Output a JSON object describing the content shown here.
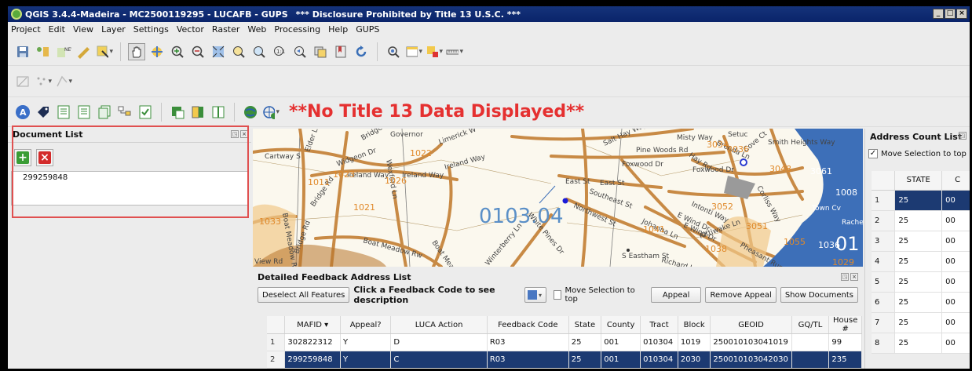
{
  "window": {
    "title": "QGIS 3.4.4-Madeira - MC2500119295 - LUCAFB - GUPS",
    "warning": "*** Disclosure Prohibited by Title 13 U.S.C. ***"
  },
  "menu": [
    "Project",
    "Edit",
    "View",
    "Layer",
    "Settings",
    "Vector",
    "Raster",
    "Web",
    "Processing",
    "Help",
    "GUPS"
  ],
  "banner": "**No Title 13 Data Displayed**",
  "document_list": {
    "title": "Document List",
    "items": [
      "299259848"
    ]
  },
  "map": {
    "tract_label": "0103.04",
    "streets": [
      "Cartway S",
      "Elder Ln",
      "Widgeon Dr",
      "Bridge",
      "Governor",
      "Limerick W",
      "Ireland Way",
      "Ireland Way",
      "Ireland Way",
      "Wexford Ln",
      "Bridge Rd",
      "Boat Meadow Rd",
      "Boat Meadow Rw",
      "Bridge Rd",
      "View Rd",
      "Boat Mead",
      "Winterberry Ln",
      "White Pines Dr",
      "Salt Hay Way",
      "Pine Woods Rd",
      "Foxwood Dr",
      "Foxwood Dr",
      "Hay Rd",
      "East St",
      "East St",
      "Southeast St",
      "Northwest St",
      "Johanna Ln",
      "S Eastham St",
      "Misty Way",
      "Brenda Ln",
      "Cove Ct",
      "Corliss Way",
      "Intonti Way",
      "E Wind Dr",
      "E Wind Dr",
      "Kittiwake Ln",
      "Pheasant Run",
      "Richard Ln",
      "Smith Heights Way",
      "Setuc",
      "Town Cv",
      "Rachel"
    ],
    "blocks": [
      "1022",
      "1023",
      "1011",
      "1026",
      "1021",
      "1033",
      "3034",
      "3036",
      "3048",
      "3061",
      "3052",
      "3051",
      "1041",
      "1038",
      "1055",
      "1008",
      "1036",
      "1029"
    ]
  },
  "feedback": {
    "title": "Detailed Feedback Address List",
    "buttons": {
      "deselect": "Deselect All Features",
      "hint": "Click a Feedback Code to see description",
      "move_top": "Move Selection to top",
      "appeal": "Appeal",
      "remove_appeal": "Remove Appeal",
      "show_docs": "Show Documents"
    },
    "columns": [
      "MAFID",
      "Appeal?",
      "LUCA Action",
      "Feedback Code",
      "State",
      "County",
      "Tract",
      "Block",
      "GEOID",
      "GQ/TL",
      "House #"
    ],
    "rows": [
      {
        "n": "1",
        "cells": [
          "302822312",
          "Y",
          "D",
          "R03",
          "25",
          "001",
          "010304",
          "1019",
          "250010103041019",
          "",
          "99"
        ],
        "selected": false
      },
      {
        "n": "2",
        "cells": [
          "299259848",
          "Y",
          "C",
          "R03",
          "25",
          "001",
          "010304",
          "2030",
          "250010103042030",
          "",
          "235"
        ],
        "selected": true
      }
    ]
  },
  "address_count": {
    "title": "Address Count List",
    "move_top": "Move Selection to top",
    "check_mark": "✓",
    "columns": [
      "STATE",
      "C"
    ],
    "rows": [
      {
        "n": "1",
        "state": "25",
        "c": "00"
      },
      {
        "n": "2",
        "state": "25",
        "c": "00"
      },
      {
        "n": "3",
        "state": "25",
        "c": "00"
      },
      {
        "n": "4",
        "state": "25",
        "c": "00"
      },
      {
        "n": "5",
        "state": "25",
        "c": "00"
      },
      {
        "n": "6",
        "state": "25",
        "c": "00"
      },
      {
        "n": "7",
        "state": "25",
        "c": "00"
      },
      {
        "n": "8",
        "state": "25",
        "c": "00"
      }
    ]
  }
}
